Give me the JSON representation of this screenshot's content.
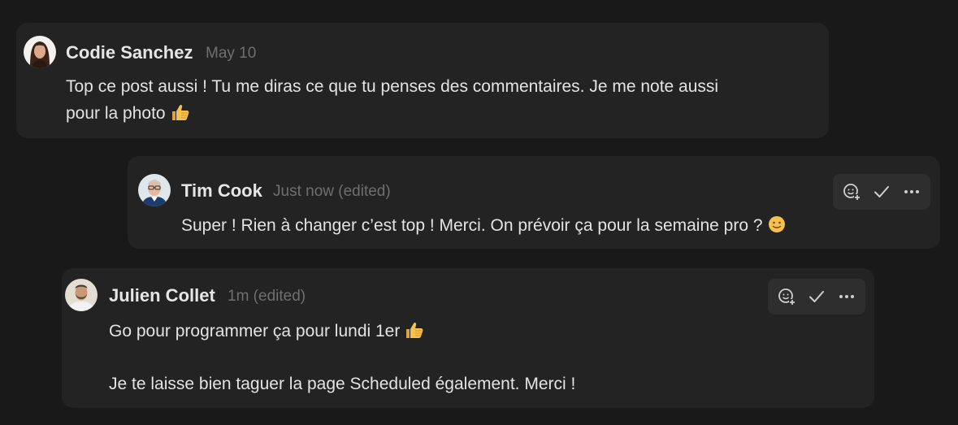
{
  "comments": [
    {
      "author": "Codie Sanchez",
      "time": "May 10",
      "lines": [
        "Top ce post aussi ! Tu me diras ce que tu penses des commentaires. Je me note aussi",
        "pour la photo"
      ],
      "avatar_icon": "woman-dark-hair-portrait",
      "trailing_emoji": "thumbs-up-emoji"
    },
    {
      "author": "Tim Cook",
      "time": "Just now (edited)",
      "lines": [
        "Super ! Rien à changer c’est top ! Merci. On prévoir ça pour la semaine pro ?"
      ],
      "avatar_icon": "man-glasses-portrait",
      "trailing_emoji": "slight-smile-emoji",
      "actions": [
        "add-reaction-icon",
        "resolve-check-icon",
        "more-options-icon"
      ]
    },
    {
      "author": "Julien Collet",
      "time": "1m (edited)",
      "lines": [
        "Go pour programmer ça pour lundi 1er",
        "",
        "Je te laisse bien taguer la page Scheduled également. Merci !"
      ],
      "avatar_icon": "man-beard-portrait",
      "trailing_emoji": "thumbs-up-emoji",
      "actions": [
        "add-reaction-icon",
        "resolve-check-icon",
        "more-options-icon"
      ]
    }
  ],
  "colors": {
    "background": "#191919",
    "card": "#232323",
    "action_bar": "#2e2e2e",
    "text": "#e3e3e3",
    "muted": "#6f6f6f"
  }
}
